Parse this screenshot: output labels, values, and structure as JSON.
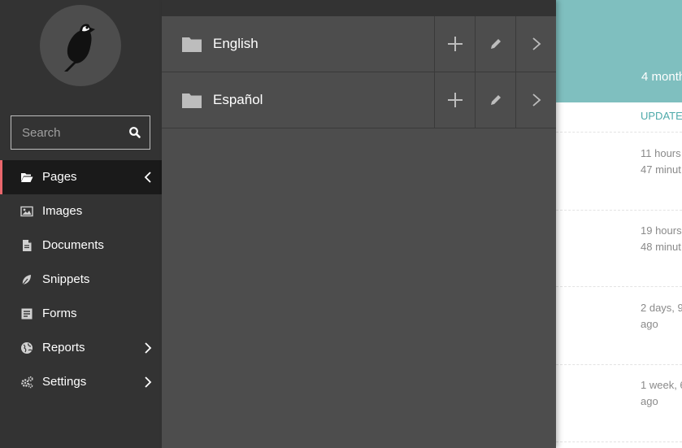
{
  "search": {
    "placeholder": "Search"
  },
  "menu": {
    "items": [
      {
        "label": "Pages",
        "icon": "folder-open-icon",
        "active": true,
        "arrow": "chevron-left-icon"
      },
      {
        "label": "Images",
        "icon": "image-icon"
      },
      {
        "label": "Documents",
        "icon": "document-icon"
      },
      {
        "label": "Snippets",
        "icon": "snippet-icon"
      },
      {
        "label": "Forms",
        "icon": "form-icon"
      },
      {
        "label": "Reports",
        "icon": "globe-icon",
        "arrow": "chevron-right-icon"
      },
      {
        "label": "Settings",
        "icon": "cogs-icon",
        "arrow": "chevron-right-icon"
      }
    ]
  },
  "explorer": {
    "rows": [
      {
        "label": "English"
      },
      {
        "label": "Español"
      }
    ]
  },
  "main": {
    "header_text": "4 month",
    "column_header": "UPDATED",
    "rows": [
      {
        "line1": "11 hours",
        "line2": "47 minut"
      },
      {
        "line1": "19 hours",
        "line2": "48 minut"
      },
      {
        "line1": "2 days, 9",
        "line2": "ago"
      },
      {
        "line1": "1 week, 6",
        "line2": "ago"
      }
    ]
  },
  "colors": {
    "sidebar": "#333333",
    "explorer": "#4d4d4d",
    "accent": "#e9666c",
    "header": "#7fbfbf"
  }
}
